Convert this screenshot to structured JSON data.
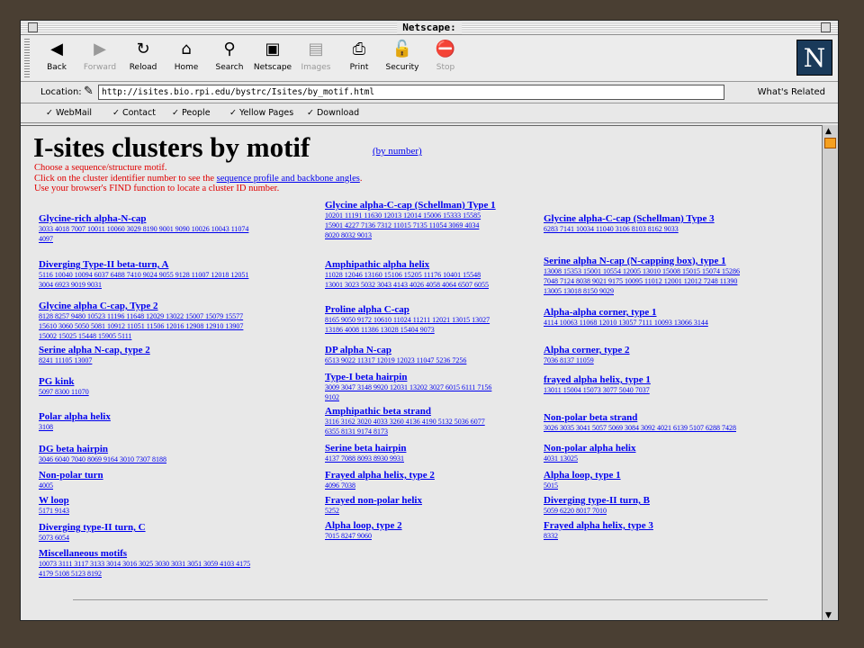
{
  "window": {
    "title": "Netscape:"
  },
  "toolbar": {
    "buttons": [
      {
        "label": "Back",
        "icon": "arrow-left-icon",
        "enabled": true
      },
      {
        "label": "Forward",
        "icon": "arrow-right-icon",
        "enabled": false
      },
      {
        "label": "Reload",
        "icon": "reload-icon",
        "enabled": true
      },
      {
        "label": "Home",
        "icon": "home-icon",
        "enabled": true
      },
      {
        "label": "Search",
        "icon": "search-icon",
        "enabled": true
      },
      {
        "label": "Netscape",
        "icon": "netscape-icon",
        "enabled": true
      },
      {
        "label": "Images",
        "icon": "images-icon",
        "enabled": false
      },
      {
        "label": "Print",
        "icon": "print-icon",
        "enabled": true
      },
      {
        "label": "Security",
        "icon": "lock-icon",
        "enabled": true
      },
      {
        "label": "Stop",
        "icon": "stop-icon",
        "enabled": false
      }
    ]
  },
  "location": {
    "label": "Location:",
    "url": "http://isites.bio.rpi.edu/bystrc/Isites/by_motif.html",
    "related": "What's Related"
  },
  "personal": [
    "WebMail",
    "Contact",
    "People",
    "Yellow Pages",
    "Download"
  ],
  "page": {
    "title": "I-sites clusters by motif",
    "by_number": "(by number)",
    "intro1": "Choose a sequence/structure motif.",
    "intro2a": "Click on the cluster identifier number to see the ",
    "intro2link": "sequence profile and backbone angles",
    "intro2b": ".",
    "intro3": "Use your browser's FIND function to locate a cluster ID number."
  },
  "motifs": {
    "col1": [
      {
        "name": "Glycine-rich alpha-N-cap",
        "ids": [
          "3033 4018 7007 10011 10060 3029 8190 9001 9090 10026 10043 11074",
          "4097"
        ]
      },
      {
        "name": "Diverging Type-II beta-turn, A",
        "ids": [
          "5116 10040 10094 6037 6488 7410 9024 9055 9128 11007 12018 12051",
          "3004 6923 9019 9031"
        ]
      },
      {
        "name": "Glycine alpha C-cap, Type 2",
        "ids": [
          "8128 8257 9480 10523 11196 11648 12029 13022 15007 15079 15577",
          "15610 3060 5050 5081 10912 11051 11506 12016 12908 12910 13907",
          "15002 15025 15448 15905 5111"
        ]
      },
      {
        "name": "Serine alpha N-cap, type 2",
        "ids": [
          "8241 11105 13007"
        ]
      },
      {
        "name": "PG kink",
        "ids": [
          "5097 8300 11070"
        ]
      },
      {
        "name": "Polar alpha helix",
        "ids": [
          "3108"
        ]
      },
      {
        "name": "DG beta hairpin",
        "ids": [
          "3046 6040 7040 8069 9164 3010 7307 8188"
        ]
      },
      {
        "name": "Non-polar turn",
        "ids": [
          "4005"
        ]
      },
      {
        "name": "W loop",
        "ids": [
          "5171 9143"
        ]
      },
      {
        "name": "Diverging type-II turn, C",
        "ids": [
          "5073 6054"
        ]
      },
      {
        "name": "Miscellaneous motifs",
        "ids": [
          "10073 3111 3117 3133 3014 3016 3025 3030 3031 3051 3059 4103 4175",
          "4179 5108 5123 8192"
        ]
      }
    ],
    "col2": [
      {
        "name": "Glycine alpha-C-cap (Schellman) Type 1",
        "ids": [
          "10201 11191 11630 12013 12014 15006 15333 15585",
          "15901 4227 7136 7312 11015 7135 11054 3069 4034",
          "8020 8032 9013"
        ]
      },
      {
        "name": "Amphipathic alpha helix",
        "ids": [
          "11028 12046 13160 15106 15205 11176 10401 15548",
          "13001 3023 5032 3043 4143 4026 4058 4064 6507 6055"
        ]
      },
      {
        "name": "Proline alpha C-cap",
        "ids": [
          "8165 9050 9172 10610 11024 11211 12021 13015 13027",
          "13186 4008 11386 13028 15404 9073"
        ]
      },
      {
        "name": "DP alpha N-cap",
        "ids": [
          "6513 9022 11317 12019 12023 11047 5236 7256"
        ]
      },
      {
        "name": "Type-I beta hairpin",
        "ids": [
          "3009 3047 3148 9920 12031 13202 3027 6015 6111 7156",
          "9102"
        ]
      },
      {
        "name": "Amphipathic beta strand",
        "ids": [
          "3116 3162 3020 4033 3260 4136 4190 5132 5036 6077",
          "6355 8131 9174 8173"
        ]
      },
      {
        "name": "Serine beta hairpin",
        "ids": [
          "4137 7088 8093 8930 9931"
        ]
      },
      {
        "name": "Frayed alpha helix, type 2",
        "ids": [
          "4096 7038"
        ]
      },
      {
        "name": "Frayed non-polar helix",
        "ids": [
          "5252"
        ]
      },
      {
        "name": "Alpha loop, type 2",
        "ids": [
          "7015 8247 9060"
        ]
      }
    ],
    "col3": [
      {
        "name": "Glycine alpha-C-cap (Schellman) Type 3",
        "ids": [
          "6283 7141 10034 11040 3106 8103 8162 9033"
        ]
      },
      {
        "name": "Serine alpha N-cap (N-capping box), type 1",
        "ids": [
          "13008 15353 15001 10554 12005 13010 15008 15015 15074 15286",
          "7048 7124 8038 9021 9175 10095 11012 12001 12012 7248 11390",
          "13005 13018 8150 9029"
        ]
      },
      {
        "name": "Alpha-alpha corner, type 1",
        "ids": [
          "4114 10063 11068 12010 13057 7111 10093 13066 3144"
        ]
      },
      {
        "name": "Alpha corner, type 2",
        "ids": [
          "7036 8137 11059"
        ]
      },
      {
        "name": "frayed alpha helix, type 1",
        "ids": [
          "13011 15004 15073 3077 5040 7037"
        ]
      },
      {
        "name": "Non-polar beta strand",
        "ids": [
          "3026 3035 3041 5057 5069 3084 3092 4021 6139 5107 6288 7428"
        ]
      },
      {
        "name": "Non-polar alpha helix",
        "ids": [
          "4031 13025"
        ]
      },
      {
        "name": "Alpha loop, type 1",
        "ids": [
          "5015"
        ]
      },
      {
        "name": "Diverging type-II turn, B",
        "ids": [
          "5059 6220 8017 7010"
        ]
      },
      {
        "name": "Frayed alpha helix, type 3",
        "ids": [
          "8332"
        ]
      }
    ]
  }
}
